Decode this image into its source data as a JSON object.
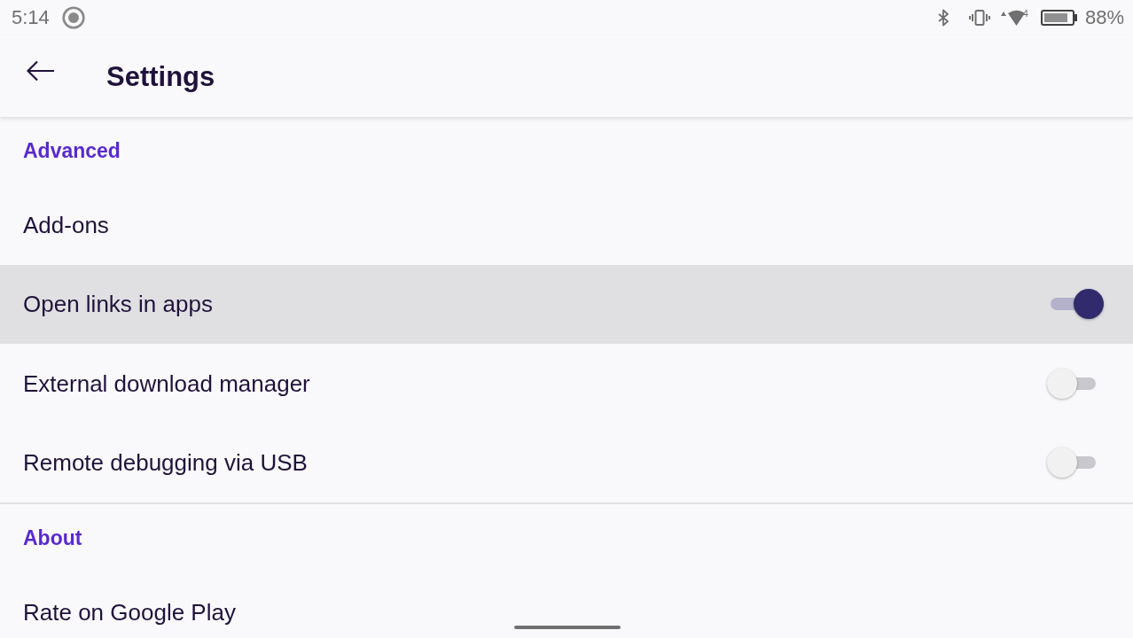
{
  "status_bar": {
    "time": "5:14",
    "network_badge": "4",
    "battery": "88%"
  },
  "app_bar": {
    "title": "Settings"
  },
  "sections": [
    {
      "title": "Advanced",
      "items": [
        {
          "kind": "link",
          "label": "Add-ons",
          "selected": false
        },
        {
          "kind": "switch",
          "label": "Open links in apps",
          "on": true,
          "selected": true
        },
        {
          "kind": "switch",
          "label": "External download manager",
          "on": false,
          "selected": false
        },
        {
          "kind": "switch",
          "label": "Remote debugging via USB",
          "on": false,
          "selected": false
        }
      ]
    },
    {
      "title": "About",
      "items": [
        {
          "kind": "link",
          "label": "Rate on Google Play",
          "selected": false
        }
      ]
    }
  ]
}
